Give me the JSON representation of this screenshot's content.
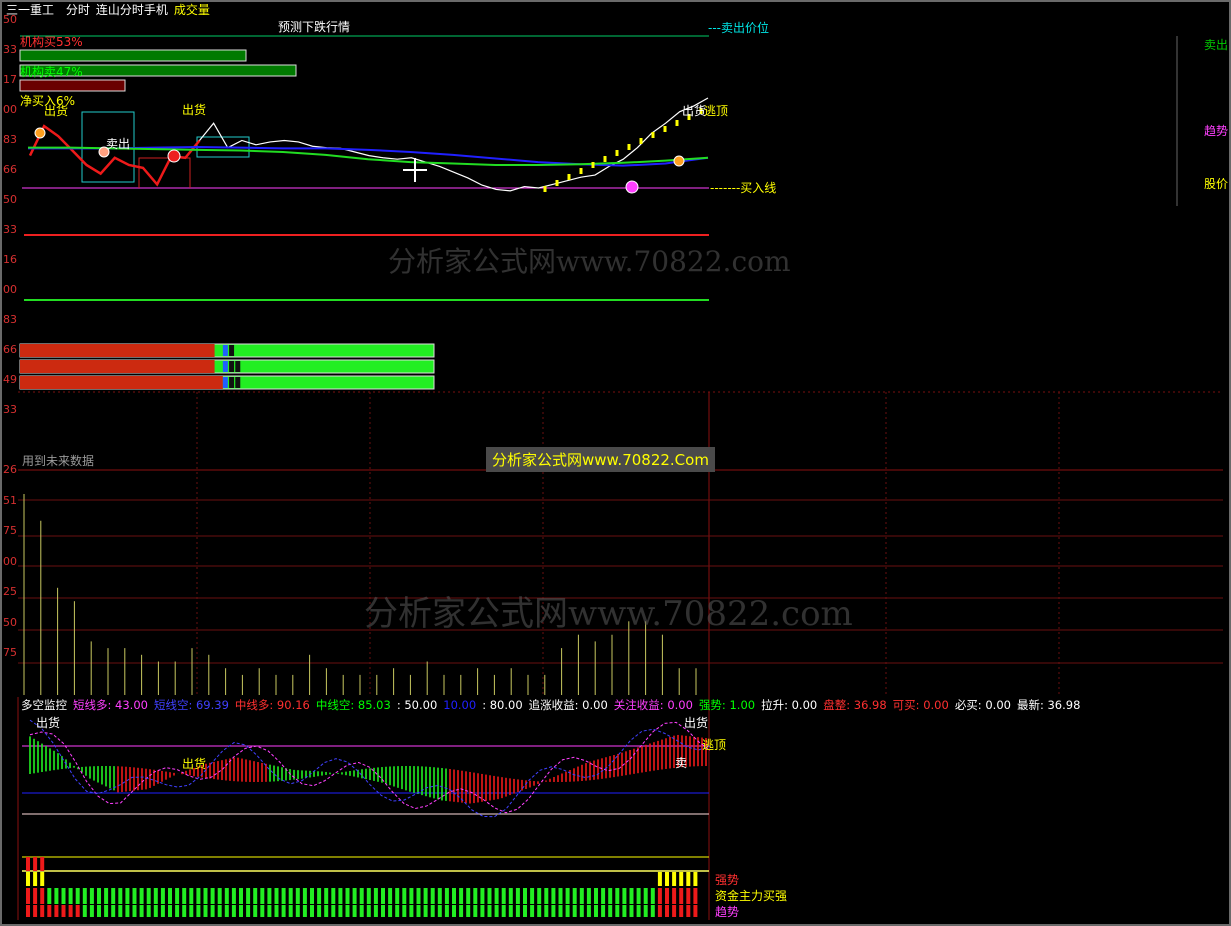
{
  "header": {
    "stock_name": "三一重工",
    "tabs": [
      {
        "label": "分时",
        "color": "#ffffff"
      },
      {
        "label": "连山分时手机",
        "color": "#ffffff"
      },
      {
        "label": "成交量",
        "color": "#ffff00"
      }
    ]
  },
  "main_panel": {
    "title": "预测下跌行情",
    "sell_price_line_label": "---卖出价位",
    "buy_line_label": "-------买入线",
    "institution_buy": {
      "label": "机构买53%",
      "percent": 53
    },
    "institution_sell": {
      "label": "机构卖47%",
      "percent": 47
    },
    "net_buy": {
      "label": "净买入6%",
      "percent": 6
    },
    "left_axis": [
      "50",
      "33",
      "17",
      "00",
      "83",
      "66",
      "50",
      "33",
      "16",
      "00",
      "83",
      "66",
      "49",
      "33"
    ],
    "annotations": [
      {
        "text": "出货",
        "color": "#ffff00"
      },
      {
        "text": "出货",
        "color": "#ffff00"
      },
      {
        "text": "卖出",
        "color": "#ffffff"
      },
      {
        "text": "出货",
        "color": "#ffffff"
      },
      {
        "text": "逃顶",
        "color": "#ffff00"
      }
    ],
    "right_panel": [
      {
        "text": "卖出",
        "color": "#00cc00"
      },
      {
        "text": "趋势",
        "color": "#ff40ff"
      },
      {
        "text": "股价",
        "color": "#ffff00"
      }
    ],
    "watermark": "分析家公式网www.70822.com",
    "bars": [
      {
        "red": 0.47,
        "marks": [
          0.3,
          0.31
        ]
      },
      {
        "red": 0.47,
        "marks": [
          0.3,
          0.31,
          0.345
        ]
      },
      {
        "red": 0.49,
        "marks": [
          0.31,
          0.32,
          0.33
        ]
      }
    ]
  },
  "volume_panel": {
    "note": "用到未来数据",
    "banner": "分析家公式网www.70822.Com",
    "left_axis": [
      "26",
      "51",
      "75",
      "00",
      "25",
      "50",
      "75"
    ],
    "watermark": "分析家公式网www.70822.com"
  },
  "indicator_bar": [
    {
      "text": "多空监控",
      "color": "#ffffff"
    },
    {
      "text": "短线多: 43.00",
      "color": "#ff40ff"
    },
    {
      "text": "短线空: 69.39",
      "color": "#4040ff"
    },
    {
      "text": "中线多: 90.16",
      "color": "#ff3030"
    },
    {
      "text": "中线空: 85.03",
      "color": "#00ff00"
    },
    {
      "text": ": 50.00",
      "color": "#ffffff"
    },
    {
      "text": "10.00",
      "color": "#2020ff"
    },
    {
      "text": ": 80.00",
      "color": "#ffffff"
    },
    {
      "text": "追涨收益: 0.00",
      "color": "#ffffff"
    },
    {
      "text": "关注收益: 0.00",
      "color": "#ff40ff"
    },
    {
      "text": "强势: 1.00",
      "color": "#00ff00"
    },
    {
      "text": "拉升: 0.00",
      "color": "#ffffff"
    },
    {
      "text": "盘整: 36.98",
      "color": "#ff3030"
    },
    {
      "text": "可买: 0.00",
      "color": "#ff3030"
    },
    {
      "text": "必买: 0.00",
      "color": "#ffffff"
    },
    {
      "text": "最新: 36.98",
      "color": "#ffffff"
    }
  ],
  "oscillator_panel": {
    "annotations": [
      {
        "text": "出货",
        "color": "#ffffff"
      },
      {
        "text": "出货",
        "color": "#ffff00"
      },
      {
        "text": "出货",
        "color": "#ffffff"
      },
      {
        "text": "逃顶",
        "color": "#ffff00"
      },
      {
        "text": "卖",
        "color": "#ffffff"
      }
    ],
    "legend": [
      {
        "text": "强势",
        "color": "#ff3030"
      },
      {
        "text": "资金主力买强",
        "color": "#ffff00"
      },
      {
        "text": "趋势",
        "color": "#ff40ff"
      }
    ]
  },
  "chart_data": {
    "type": "line",
    "price_series": [
      0.45,
      0.86,
      0.72,
      0.52,
      0.32,
      0.2,
      0.42,
      0.32,
      0.28,
      0.05,
      0.44,
      0.42,
      0.66,
      0.9,
      0.56,
      0.66,
      0.6,
      0.64,
      0.66,
      0.64,
      0.58,
      0.56,
      0.55,
      0.5,
      0.45,
      0.42,
      0.4,
      0.42,
      0.36,
      0.3,
      0.22,
      0.14,
      0.04,
      -0.02,
      -0.04,
      0.02,
      0.0,
      0.05,
      0.1,
      0.15,
      0.18,
      0.3,
      0.4,
      0.56,
      0.76,
      0.9,
      1.06,
      1.14,
      1.25
    ],
    "short_sma": [
      0.55,
      0.55,
      0.55,
      0.56,
      0.57,
      0.56,
      0.55,
      0.55,
      0.53,
      0.5,
      0.46,
      0.41,
      0.36,
      0.33,
      0.31,
      0.34,
      0.42
    ],
    "long_sma": [
      0.56,
      0.56,
      0.55,
      0.54,
      0.53,
      0.52,
      0.5,
      0.46,
      0.4,
      0.36,
      0.34,
      0.32,
      0.32,
      0.33,
      0.35,
      0.38,
      0.42
    ],
    "volume": [
      3.0,
      2.6,
      1.6,
      1.4,
      0.8,
      0.7,
      0.7,
      0.6,
      0.5,
      0.5,
      0.7,
      0.6,
      0.4,
      0.3,
      0.4,
      0.3,
      0.3,
      0.6,
      0.4,
      0.3,
      0.3,
      0.3,
      0.4,
      0.3,
      0.5,
      0.3,
      0.3,
      0.4,
      0.3,
      0.4,
      0.3,
      0.3,
      0.7,
      0.9,
      0.8,
      0.9,
      1.1,
      1.1,
      0.9,
      0.4,
      0.4
    ],
    "oscillator": [
      0.92,
      0.7,
      0.4,
      0.22,
      0.26,
      0.45,
      0.58,
      0.66,
      0.58,
      0.5,
      0.48,
      0.42,
      0.34,
      0.22,
      0.12,
      0.08,
      0.14,
      0.28,
      0.44,
      0.6,
      0.7,
      0.82,
      0.94,
      0.9
    ]
  }
}
